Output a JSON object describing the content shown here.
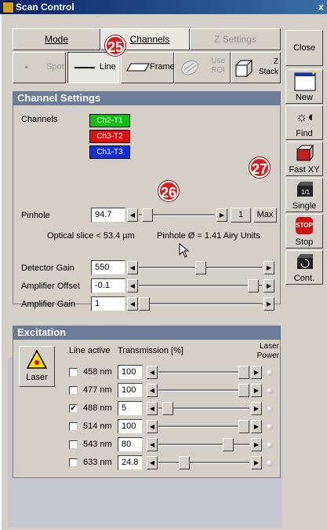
{
  "window": {
    "title": "Scan Control",
    "close_glyph": "x"
  },
  "tabs": [
    {
      "label": "Mode",
      "state": "normal"
    },
    {
      "label": "Channels",
      "state": "active"
    },
    {
      "label": "Z Settings",
      "state": "disabled"
    }
  ],
  "modes": {
    "spot": "Spot",
    "line": "Line",
    "frame": "Frame",
    "use_roi": "Use ROI",
    "z_stack": "Z Stack"
  },
  "channel_settings": {
    "header": "Channel Settings",
    "channels_label": "Channels",
    "channels": [
      {
        "label": "Ch2-T1",
        "color": "#10c010",
        "text_color": "#ffffff"
      },
      {
        "label": "Ch3-T2",
        "color": "#e01010",
        "text_color": "#ffffff"
      },
      {
        "label": "Ch1-T3",
        "color": "#1030e0",
        "text_color": "#ffffff"
      }
    ],
    "pinhole_label": "Pinhole",
    "pinhole_value": "94.7",
    "pinhole_one_btn": "1",
    "pinhole_max_btn": "Max",
    "optical_slice": "Optical slice < 53.4 µm",
    "pinhole_airy": "Pinhole Ø = 1.41 Airy Units",
    "detector_gain_label": "Detector Gain",
    "detector_gain_value": "550",
    "amp_offset_label": "Amplifier Offset",
    "amp_offset_value": "-0.1",
    "amp_gain_label": "Amplifier Gain",
    "amp_gain_value": "1",
    "slider_levels": {
      "pinhole": 0.05,
      "detector_gain": 0.5,
      "amp_offset": 0.97,
      "amp_gain": 0.0
    }
  },
  "excitation": {
    "header": "Excitation",
    "laser_button": "Laser",
    "col_line_active": "Line active",
    "col_transmission": "Transmission [%]",
    "col_laser_power": "Laser Power",
    "lines": [
      {
        "nm": "458 nm",
        "checked": false,
        "value": "100",
        "level": 1.0
      },
      {
        "nm": "477 nm",
        "checked": false,
        "value": "100",
        "level": 1.0
      },
      {
        "nm": "488 nm",
        "checked": true,
        "value": "5",
        "level": 0.05
      },
      {
        "nm": "514 nm",
        "checked": false,
        "value": "100",
        "level": 1.0
      },
      {
        "nm": "543 nm",
        "checked": false,
        "value": "80",
        "level": 0.8
      },
      {
        "nm": "633 nm",
        "checked": false,
        "value": "24.8",
        "level": 0.25
      }
    ]
  },
  "right_toolbar": {
    "close": "Close",
    "new": "New",
    "find": "Find",
    "fast_xy": "Fast XY",
    "single": "Single",
    "stop": "Stop",
    "stop_icon": "STOP",
    "cont": "Cont."
  },
  "callouts": [
    "25",
    "26",
    "27"
  ]
}
